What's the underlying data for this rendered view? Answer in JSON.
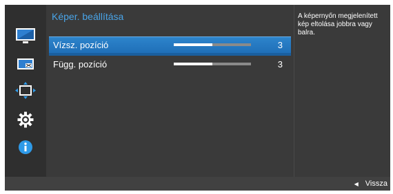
{
  "menu": {
    "title": "Képer. beállítása",
    "items": [
      {
        "label": "Vízsz. pozíció",
        "value": "3",
        "level": 0.5,
        "selected": true
      },
      {
        "label": "Függ. pozíció",
        "value": "3",
        "level": 0.5,
        "selected": false
      }
    ]
  },
  "help_text": "A képernyőn megjelenített kép eltolása jobbra vagy balra.",
  "footer": {
    "back_label": "Vissza",
    "back_icon": "triangle-left-icon"
  },
  "sidebar_icons": [
    "picture-icon",
    "pip-icon",
    "position-icon",
    "gear-icon",
    "info-icon"
  ],
  "colors": {
    "accent": "#2e85cc",
    "title": "#49a4e8"
  }
}
